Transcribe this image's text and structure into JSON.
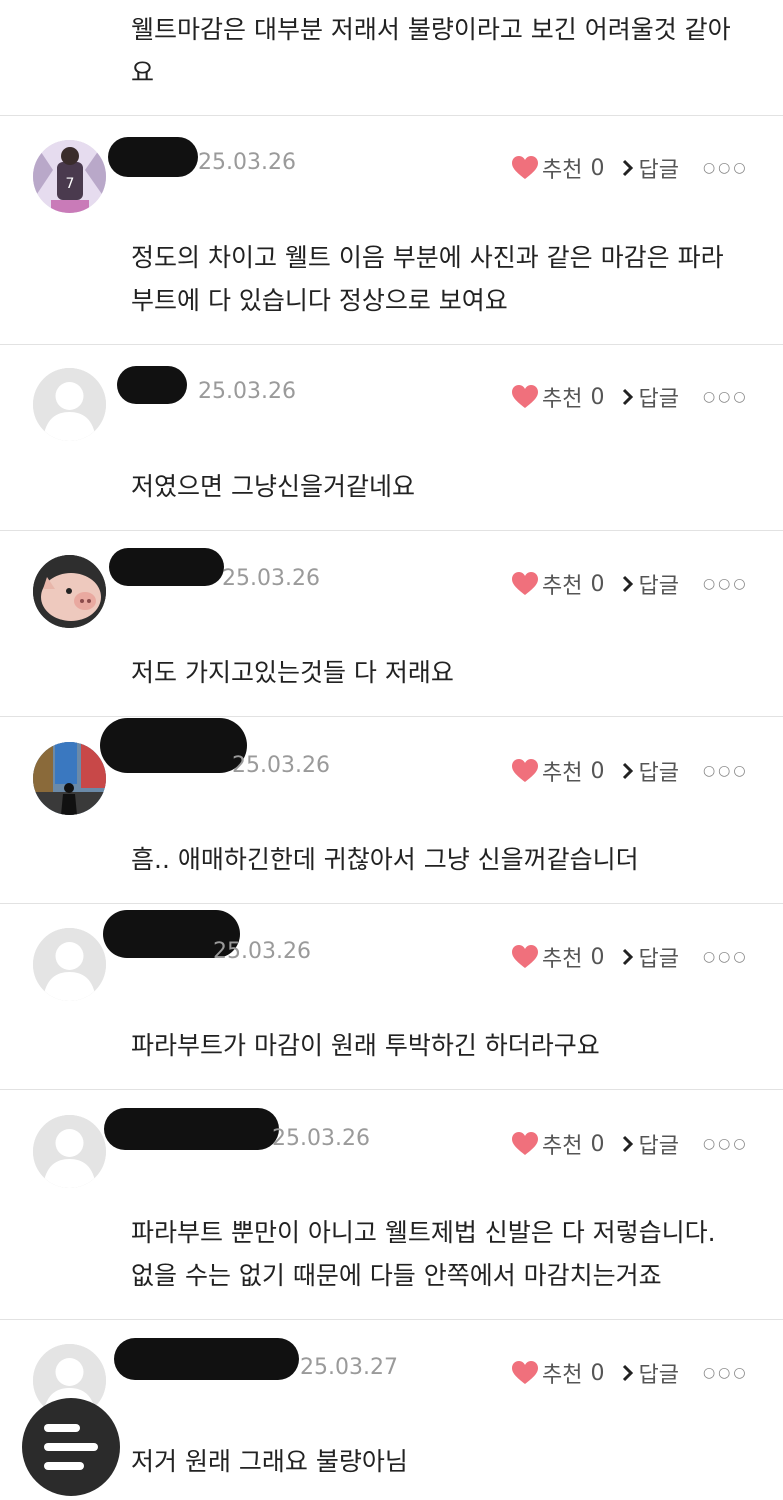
{
  "top_comment": {
    "lines": [
      "웰트마감은 대부분 저래서 불량이라고 보긴 어려울것 같아",
      "요"
    ]
  },
  "ui": {
    "recommend_label": "추천",
    "reply_label": "답글",
    "more_icon": "more-dots-icon",
    "heart_color": "#f0707c"
  },
  "comments": [
    {
      "date": "25.03.26",
      "recommend_count": "0",
      "lines": [
        "정도의 차이고 웰트 이음 부분에 사진과 같은 마감은 파라",
        "부트에 다 있습니다 정상으로 보여요"
      ],
      "avatar": "jersey-photo"
    },
    {
      "date": "25.03.26",
      "recommend_count": "0",
      "lines": [
        "저였으면 그냥신을거같네요"
      ],
      "avatar": "default-person"
    },
    {
      "date": "25.03.26",
      "recommend_count": "0",
      "lines": [
        "저도 가지고있는것들 다 저래요"
      ],
      "avatar": "pig-photo"
    },
    {
      "date": "25.03.26",
      "recommend_count": "0",
      "lines": [
        "흠.. 애매하긴한데 귀찮아서 그냥 신을꺼같습니더"
      ],
      "avatar": "street-photo"
    },
    {
      "date": "25.03.26",
      "recommend_count": "0",
      "lines": [
        "파라부트가 마감이 원래 투박하긴 하더라구요"
      ],
      "avatar": "default-person"
    },
    {
      "date": "25.03.26",
      "recommend_count": "0",
      "lines": [
        "파라부트 뿐만이 아니고 웰트제법 신발은 다 저렇습니다.",
        "없을 수는 없기 때문에 다들 안쪽에서 마감치는거죠"
      ],
      "avatar": "default-person"
    },
    {
      "date": "25.03.27",
      "recommend_count": "0",
      "lines": [
        "저거 원래 그래요 불량아님"
      ],
      "avatar": "default-person"
    }
  ],
  "fab": {
    "icon": "menu-list-icon"
  }
}
